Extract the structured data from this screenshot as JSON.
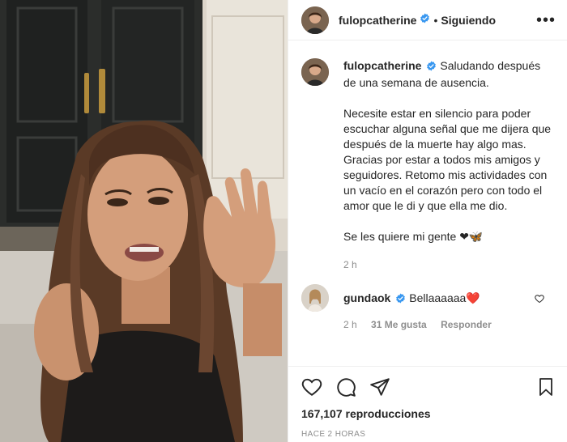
{
  "post": {
    "username": "fulopcatherine",
    "separator": "•",
    "follow_status": "Siguiendo",
    "more_icon": "more-horizontal-icon"
  },
  "caption": {
    "username": "fulopcatherine",
    "line1": "Saludando después de una semana de ausencia.",
    "line2": "Necesite estar en silencio para poder escuchar alguna señal que me dijera que después de la muerte hay algo mas. Gracias por estar a todos mis amigos y seguidores. Retomo mis actividades con un vacío en el corazón pero con todo el amor que le di y que ella me dio.",
    "line3": "Se les quiere mi gente ❤🦋",
    "time": "2 h"
  },
  "reply": {
    "username": "gundaok",
    "text": "Bellaaaaaa❤️",
    "time": "2 h",
    "likes": "31 Me gusta",
    "reply_label": "Responder"
  },
  "footer": {
    "views": "167,107 reproducciones",
    "time_ago": "HACE 2 HORAS"
  },
  "colors": {
    "verified": "#3897f0",
    "text": "#262626",
    "muted": "#8e8e8e",
    "heart": "#ed4956"
  }
}
